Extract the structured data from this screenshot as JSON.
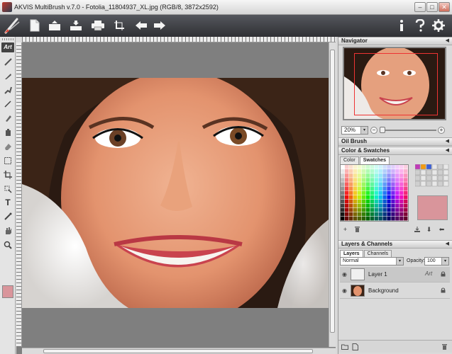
{
  "window": {
    "title": "AKVIS MultiBrush v.7.0 - Fotolia_11804937_XL.jpg (RGB/8, 3872x2592)",
    "min_glyph": "–",
    "max_glyph": "□",
    "close_glyph": "✕"
  },
  "toolbar": {
    "buttons": [
      "new-file-icon",
      "open-icon",
      "save-icon",
      "print-icon",
      "crop-icon",
      "undo-icon",
      "redo-icon",
      "info-icon",
      "help-icon",
      "settings-icon"
    ]
  },
  "tools": {
    "art_label": "Art",
    "items": [
      "brush-icon",
      "smudge-icon",
      "clone-icon",
      "pencil-icon",
      "paint-icon",
      "bucket-icon",
      "eraser-icon",
      "selection-icon",
      "crop-tool-icon",
      "transform-icon",
      "text-tool-icon",
      "eyedropper-icon",
      "hand-icon",
      "zoom-icon"
    ],
    "text_tool_glyph": "T",
    "current_color": "#d9959b"
  },
  "panels": {
    "navigator": {
      "title": "Navigator",
      "zoom": "20%",
      "zoom_minus": "−",
      "zoom_plus": "+"
    },
    "oil_brush": {
      "title": "Oil Brush"
    },
    "color_swatches": {
      "title": "Color & Swatches",
      "tab_color": "Color",
      "tab_swatches": "Swatches",
      "selected_color": "#d9959b"
    },
    "layers": {
      "title": "Layers & Channels",
      "tab_layers": "Layers",
      "tab_channels": "Channels",
      "blend_mode": "Normal",
      "opacity_label": "Opacity:",
      "opacity_value": "100",
      "items": [
        {
          "name": "Layer 1",
          "badge": "Art"
        },
        {
          "name": "Background",
          "badge": ""
        }
      ]
    }
  },
  "glyphs": {
    "collapse_arrow": "◀",
    "dropdown_arrow": "▾",
    "eye": "◉",
    "plus": "+",
    "trash": "🗑",
    "down": "⬇",
    "back": "⬅"
  }
}
